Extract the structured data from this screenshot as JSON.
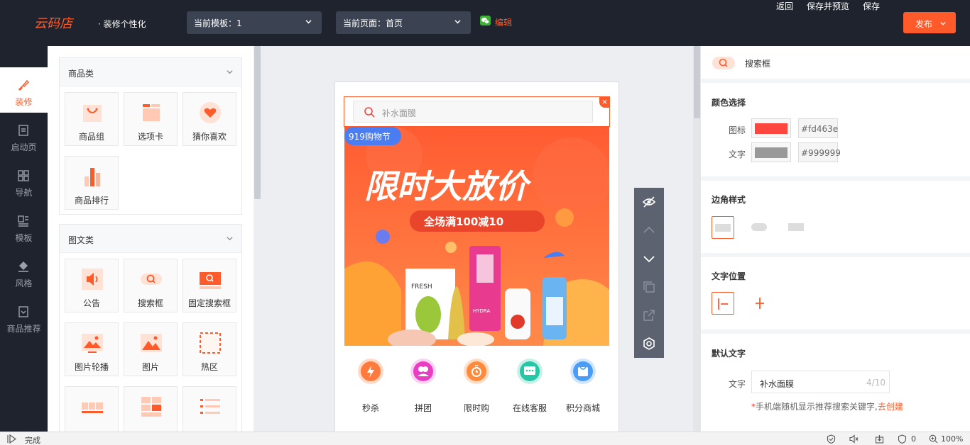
{
  "app": {
    "logo_text": "云码店",
    "subtitle": "· 装修个性化",
    "template_select": "当前模板：1",
    "page_select": "当前页面：首页",
    "edit_label": "编辑",
    "back": "返回",
    "save_preview": "保存并预览",
    "save": "保存",
    "publish": "发布",
    "accent_color": "#ff5a2a",
    "topbar_color": "#1f232d"
  },
  "leftnav": {
    "items": [
      {
        "label": "装修",
        "icon": "paint-brush-icon",
        "active": true
      },
      {
        "label": "启动页",
        "icon": "document-icon",
        "active": false
      },
      {
        "label": "导航",
        "icon": "grid-icon",
        "active": false
      },
      {
        "label": "模板",
        "icon": "template-icon",
        "active": false
      },
      {
        "label": "风格",
        "icon": "paint-bucket-icon",
        "active": false
      },
      {
        "label": "商品推荐",
        "icon": "recommend-icon",
        "active": false
      }
    ]
  },
  "widgets": {
    "groups": [
      {
        "title": "商品类",
        "items": [
          "商品组",
          "选项卡",
          "猜你喜欢",
          "商品排行"
        ]
      },
      {
        "title": "图文类",
        "items": [
          "公告",
          "搜索框",
          "固定搜索框",
          "图片轮播",
          "图片",
          "热区"
        ]
      }
    ]
  },
  "preview": {
    "search_placeholder": "补水面膜",
    "banner": {
      "festival": "919购物节",
      "headline": "限时大放价",
      "subline": "全场满100减10"
    },
    "nav": [
      {
        "label": "秒杀",
        "color": "#ff7a3c"
      },
      {
        "label": "拼团",
        "color": "#e93ec4"
      },
      {
        "label": "限时购",
        "color": "#ff8a3c"
      },
      {
        "label": "在线客服",
        "color": "#26c6a6"
      },
      {
        "label": "积分商城",
        "color": "#4a9df7"
      }
    ]
  },
  "props": {
    "component_title": "搜索框",
    "color_section": "颜色选择",
    "icon_label": "图标",
    "icon_color": "#fd463e",
    "icon_hex": "#fd463e",
    "text_label": "文字",
    "text_color": "#999999",
    "text_hex": "#999999",
    "corner_section": "边角样式",
    "text_position_section": "文字位置",
    "default_text_section": "默认文字",
    "default_text_label": "文字",
    "default_text_value": "补水面膜",
    "default_text_count": "4/10",
    "hint_star": "*",
    "hint_text": "手机端随机显示推荐搜索关键字,",
    "hint_link": "去创建"
  },
  "status": {
    "done": "完成",
    "badge_count": "0",
    "zoom": "100%"
  }
}
